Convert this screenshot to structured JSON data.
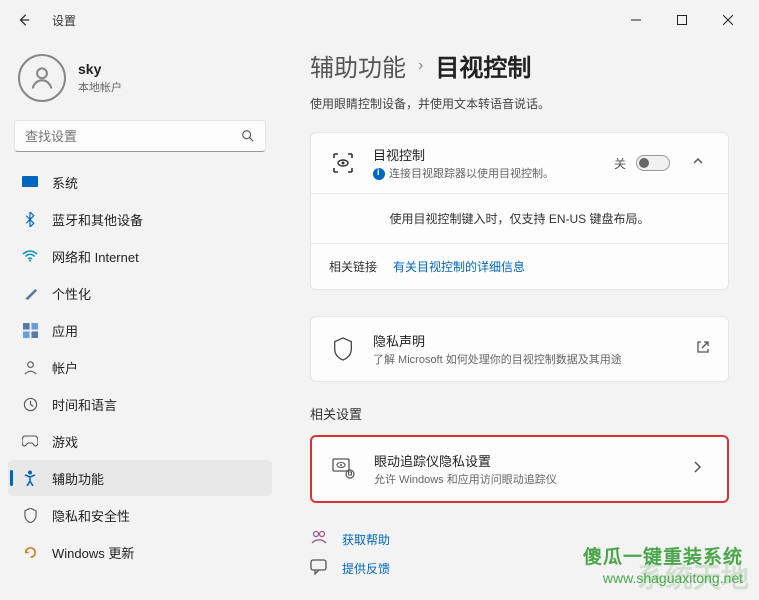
{
  "window": {
    "title": "设置"
  },
  "user": {
    "name": "sky",
    "subtitle": "本地帐户"
  },
  "search": {
    "placeholder": "查找设置"
  },
  "sidebar": {
    "items": [
      {
        "label": "系统"
      },
      {
        "label": "蓝牙和其他设备"
      },
      {
        "label": "网络和 Internet"
      },
      {
        "label": "个性化"
      },
      {
        "label": "应用"
      },
      {
        "label": "帐户"
      },
      {
        "label": "时间和语言"
      },
      {
        "label": "游戏"
      },
      {
        "label": "辅助功能"
      },
      {
        "label": "隐私和安全性"
      },
      {
        "label": "Windows 更新"
      }
    ]
  },
  "breadcrumb": {
    "parent": "辅助功能",
    "current": "目视控制"
  },
  "page": {
    "subtitle": "使用眼睛控制设备，并使用文本转语音说话。"
  },
  "eyecontrol": {
    "title": "目视控制",
    "sub": "连接目视跟踪器以使用目视控制。",
    "toggle_label": "关",
    "keyboard_note": "使用目视控制键入时，仅支持 EN-US 键盘布局。",
    "links_label": "相关链接",
    "link_text": "有关目视控制的详细信息"
  },
  "privacy": {
    "title": "隐私声明",
    "sub": "了解 Microsoft 如何处理你的目视控制数据及其用途"
  },
  "related": {
    "heading": "相关设置",
    "tracker_title": "眼动追踪仪隐私设置",
    "tracker_sub": "允许 Windows 和应用访问眼动追踪仪"
  },
  "help": {
    "get_help": "获取帮助",
    "feedback": "提供反馈"
  },
  "watermark": {
    "line1": "傻瓜一键重装系统",
    "line2": "www.shaguaxitong.net"
  }
}
